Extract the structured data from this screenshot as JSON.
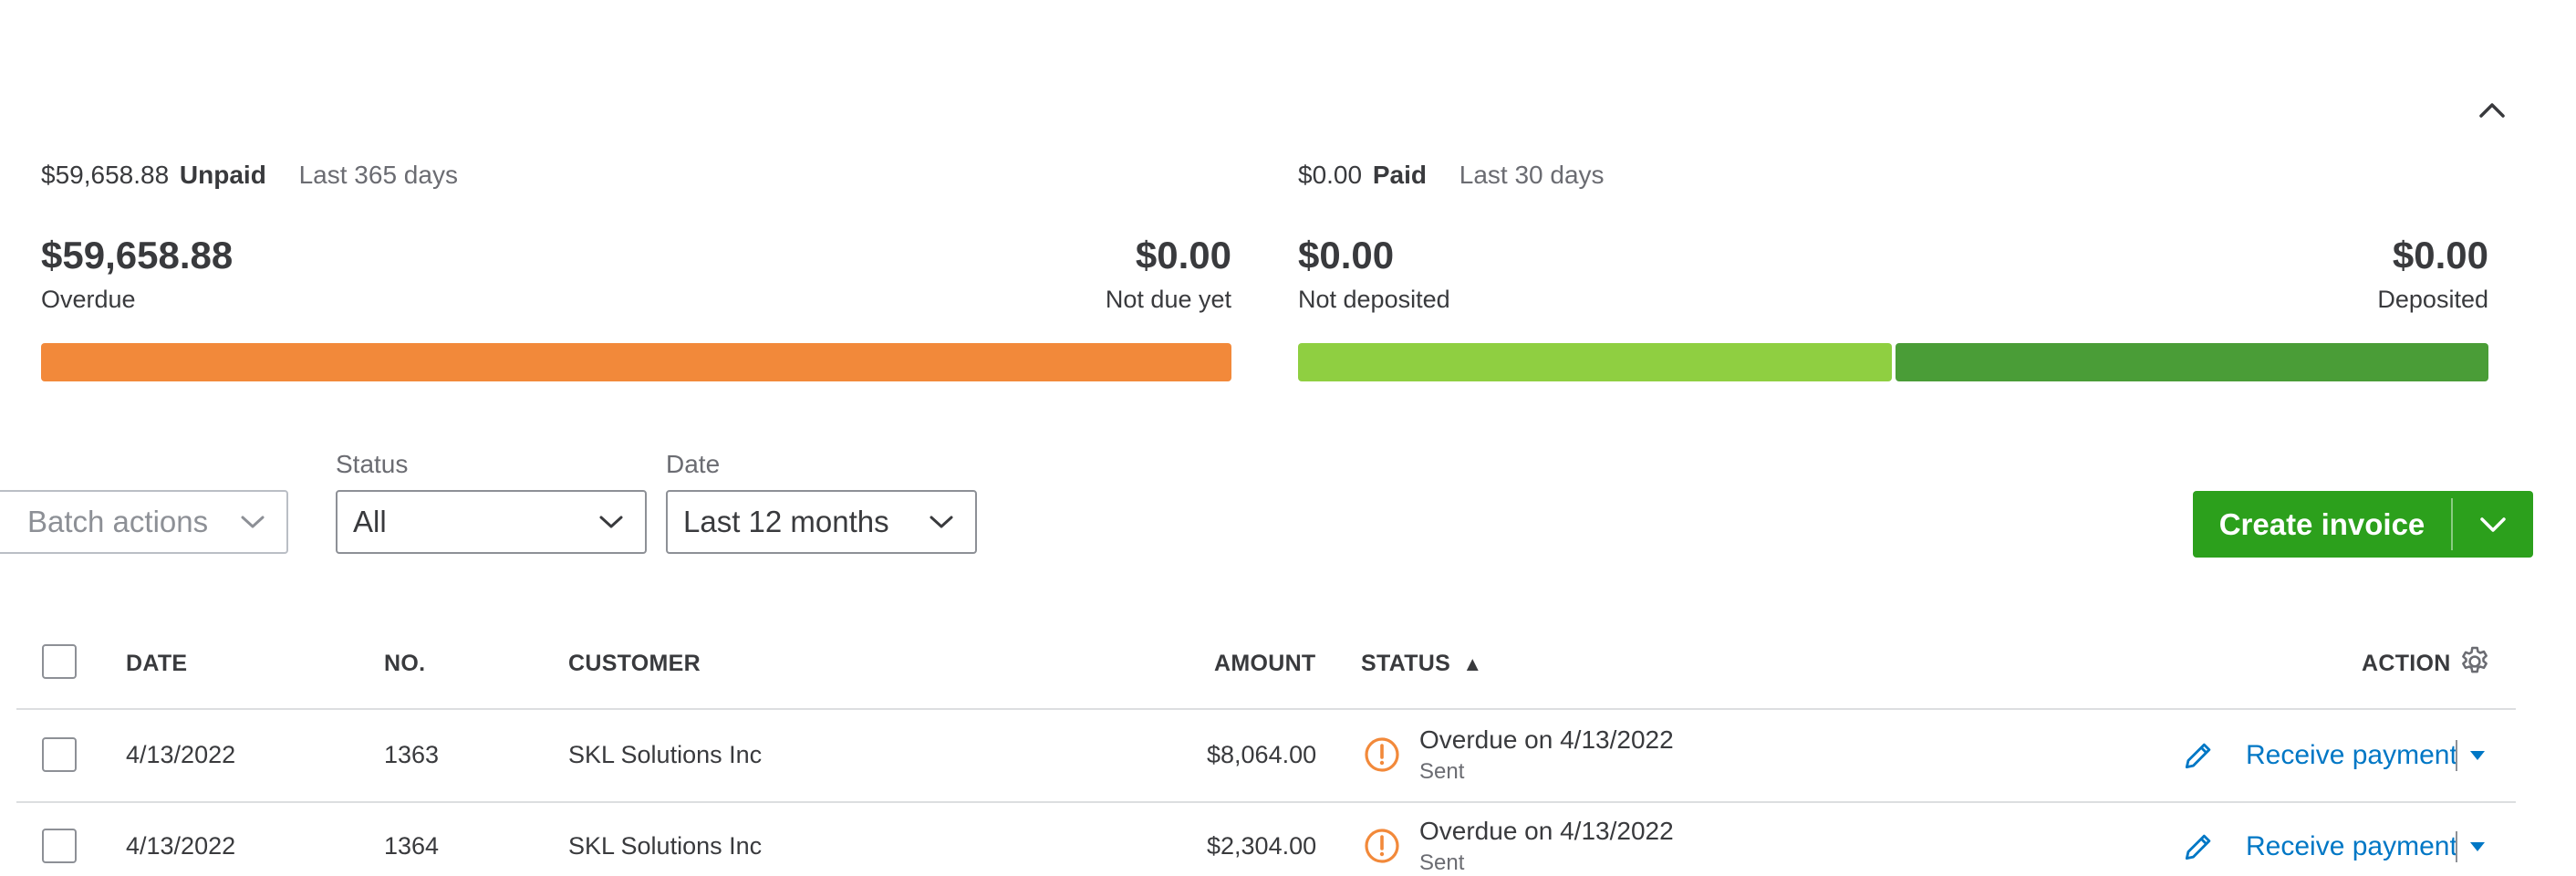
{
  "summary": {
    "unpaid": {
      "amount": "$59,658.88",
      "label": "Unpaid",
      "range": "Last 365 days",
      "left_amount": "$59,658.88",
      "left_label": "Overdue",
      "right_amount": "$0.00",
      "right_label": "Not due yet",
      "bar_color": "#f2893a"
    },
    "paid": {
      "amount": "$0.00",
      "label": "Paid",
      "range": "Last 30 days",
      "left_amount": "$0.00",
      "left_label": "Not deposited",
      "right_amount": "$0.00",
      "right_label": "Deposited",
      "bar_left_color": "#8fcf41",
      "bar_right_color": "#4a9d37"
    }
  },
  "filters": {
    "batch_actions": "Batch actions",
    "status_label": "Status",
    "status_value": "All",
    "date_label": "Date",
    "date_value": "Last 12 months"
  },
  "create_invoice": {
    "label": "Create invoice",
    "color": "#2ca01c"
  },
  "table": {
    "headers": {
      "date": "DATE",
      "no": "NO.",
      "customer": "CUSTOMER",
      "amount": "AMOUNT",
      "status": "STATUS",
      "sort_indicator": "▲",
      "action": "ACTION"
    },
    "rows": [
      {
        "date": "4/13/2022",
        "no": "1363",
        "customer": "SKL Solutions Inc",
        "amount": "$8,064.00",
        "status": "Overdue on 4/13/2022",
        "status_sub": "Sent",
        "action": "Receive payment"
      },
      {
        "date": "4/13/2022",
        "no": "1364",
        "customer": "SKL Solutions Inc",
        "amount": "$2,304.00",
        "status": "Overdue on 4/13/2022",
        "status_sub": "Sent",
        "action": "Receive payment"
      }
    ]
  },
  "icons": {
    "collapse": "chevron-up-icon",
    "dropdown": "chevron-down-icon",
    "settings": "gear-icon",
    "overdue": "warning-circle-icon",
    "edit": "pencil-icon",
    "more": "caret-down-icon"
  },
  "colors": {
    "overdue_icon": "#f2893a",
    "link": "#0077c5"
  }
}
